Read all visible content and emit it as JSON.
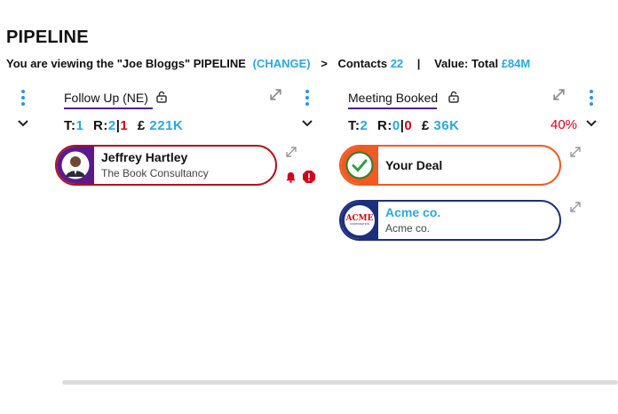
{
  "header": {
    "title": "PIPELINE",
    "viewing_prefix": "You are viewing the \"Joe Bloggs\" PIPELINE",
    "change_label": "(CHANGE)",
    "arrow": ">",
    "contacts_label": "Contacts",
    "contacts_count": "22",
    "divider": "|",
    "value_label": "Value: Total",
    "value_total": "£84M"
  },
  "columns": [
    {
      "title": "Follow Up (NE)",
      "stats": {
        "t_label": "T:",
        "t_value": "1",
        "r_label": "R:",
        "r_value_a": "2",
        "r_sep": "|",
        "r_value_b": "1",
        "currency": "£",
        "amount": "221K"
      },
      "cards": [
        {
          "name": "Jeffrey Hartley",
          "company": "The Book Consultancy",
          "border_color": "#b0121b",
          "strip_color": "#5b1a8b"
        }
      ]
    },
    {
      "title": "Meeting Booked",
      "percent": "40%",
      "stats": {
        "t_label": "T:",
        "t_value": "2",
        "r_label": "R:",
        "r_value_a": "0",
        "r_sep": "|",
        "r_value_b": "0",
        "currency": "£",
        "amount": "36K"
      },
      "cards": [
        {
          "name": "Your Deal",
          "border_color": "#f15a22",
          "strip_color": "#f15a22"
        },
        {
          "name": "Acme co.",
          "company": "Acme co.",
          "logo_text": "ACME",
          "logo_subtext": "CORPORATION",
          "border_color": "#1d2f7a",
          "strip_color": "#1d2f7a",
          "name_color": "#29a8e0"
        }
      ]
    }
  ],
  "colors": {
    "accent_blue": "#29a8e0",
    "kebab_blue": "#2196f3",
    "alert_red": "#d0021b",
    "underline_purple": "#5b1a8b"
  },
  "icons": [
    "kebab-menu-icon",
    "chevron-down-icon",
    "lock-open-icon",
    "expand-icon",
    "bell-icon",
    "alert-icon",
    "checkmark-icon"
  ]
}
